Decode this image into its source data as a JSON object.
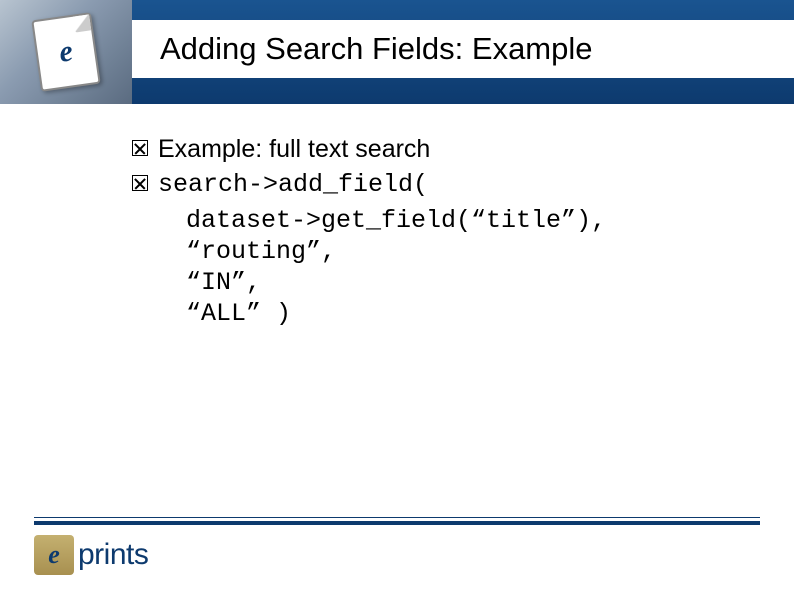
{
  "header": {
    "title": "Adding Search Fields: Example"
  },
  "content": {
    "bullet1": "Example: full text search",
    "code": {
      "line1": "search->add_field(",
      "line2": "dataset->get_field(“title”),",
      "line3": "“routing”,",
      "line4": "“IN”,",
      "line5": "“ALL” )"
    }
  },
  "footer": {
    "logo_e": "e",
    "logo_text": "prints"
  }
}
